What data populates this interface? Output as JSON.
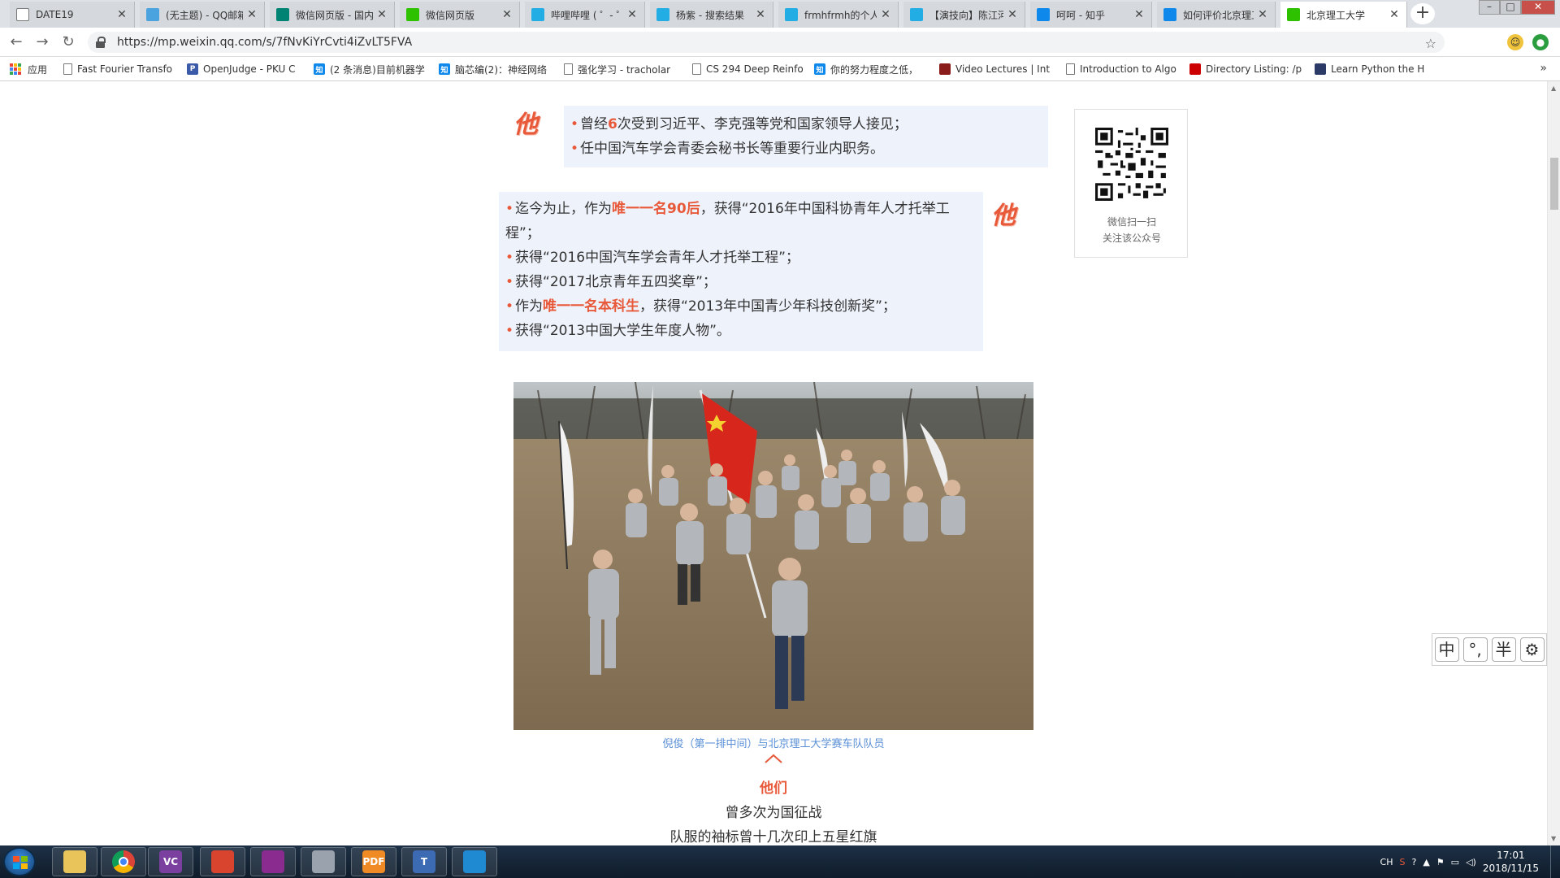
{
  "browser": {
    "tabs": [
      {
        "label": "DATE19",
        "icon": "doc-icon",
        "color": "#ffffff"
      },
      {
        "label": "(无主题) - QQ邮箱",
        "icon": "qq-mail-icon",
        "color": "#4aa3df"
      },
      {
        "label": "微信网页版 - 国内",
        "icon": "bing-icon",
        "color": "#008373"
      },
      {
        "label": "微信网页版",
        "icon": "wechat-icon",
        "color": "#2dc100"
      },
      {
        "label": "哔哩哔哩 ( ゜- ゜)つロ",
        "icon": "bilibili-icon",
        "color": "#23ade5"
      },
      {
        "label": "杨紫 - 搜索结果",
        "icon": "bilibili-icon",
        "color": "#23ade5"
      },
      {
        "label": "frmhfrmh的个人空间",
        "icon": "bilibili-icon",
        "color": "#23ade5"
      },
      {
        "label": "【演技向】陈江河",
        "icon": "bilibili-icon",
        "color": "#23ade5"
      },
      {
        "label": "呵呵 - 知乎",
        "icon": "zhihu-icon",
        "color": "#0f88eb"
      },
      {
        "label": "如何评价北京理工",
        "icon": "zhihu-icon",
        "color": "#0f88eb"
      },
      {
        "label": "北京理工大学",
        "icon": "wechat-icon",
        "color": "#2dc100",
        "active": true
      }
    ],
    "url": "https://mp.weixin.qq.com/s/7fNvKiYrCvti4iZvLT5FVA",
    "bookmarks": [
      {
        "label": "应用",
        "icon": "apps-grid-icon"
      },
      {
        "label": "Fast Fourier Transfo",
        "icon": "doc-icon"
      },
      {
        "label": "OpenJudge - PKU C",
        "icon": "poj-icon",
        "color": "#3b5ba9",
        "mark": "POJ"
      },
      {
        "label": "(2 条消息)目前机器学",
        "icon": "zhihu-icon",
        "color": "#0f88eb",
        "mark": "知"
      },
      {
        "label": "脑芯编(2)：神经网络",
        "icon": "zhihu-icon",
        "color": "#0f88eb",
        "mark": "知"
      },
      {
        "label": "强化学习 - tracholar",
        "icon": "doc-icon"
      },
      {
        "label": "CS 294 Deep Reinfo",
        "icon": "doc-icon"
      },
      {
        "label": "你的努力程度之低，",
        "icon": "zhihu-icon",
        "color": "#0f88eb",
        "mark": "知"
      },
      {
        "label": "Video Lectures | Int",
        "icon": "mit-icon",
        "color": "#8a1c1c"
      },
      {
        "label": "Introduction to Algo",
        "icon": "doc-icon"
      },
      {
        "label": "Directory Listing: /p",
        "icon": "redhat-icon",
        "color": "#cc0000"
      },
      {
        "label": "Learn Python the H",
        "icon": "book-icon",
        "color": "#2b3a67"
      }
    ],
    "more_label": "»",
    "star_label": "☆"
  },
  "article": {
    "panel1": {
      "lines": [
        [
          {
            "t": "曾经"
          },
          {
            "t": "6",
            "hl": true
          },
          {
            "t": "次受到习近平、李克强等党和国家领导人接见；"
          }
        ],
        [
          {
            "t": "任中国汽车学会青委会秘书长等重要行业内职务。"
          }
        ]
      ]
    },
    "ta_char": "他",
    "panel2": {
      "lines": [
        [
          {
            "t": "迄今为止，作为"
          },
          {
            "t": "唯一一名90后",
            "hl": true
          },
          {
            "t": "，获得“2016年中国科协青年人才托举工"
          }
        ],
        [
          {
            "t": "程”；",
            "cont": true
          }
        ],
        [
          {
            "t": "获得“2016中国汽车学会青年人才托举工程”；"
          }
        ],
        [
          {
            "t": "获得“2017北京青年五四奖章”；"
          }
        ],
        [
          {
            "t": "作为"
          },
          {
            "t": "唯一一名本科生",
            "hl": true
          },
          {
            "t": "，获得“2013年中国青少年科技创新奖”；"
          }
        ],
        [
          {
            "t": "获得“2013中国大学生年度人物”。"
          }
        ]
      ]
    },
    "qr_caption_1": "微信扫一扫",
    "qr_caption_2": "关注该公众号",
    "photo_caption": "倪俊（第一排中间）与北京理工大学赛车队队员",
    "tamen": "他们",
    "line1": "曾多次为国征战",
    "line2": "队服的袖标曾十几次印上五星红旗"
  },
  "ime": {
    "labels": [
      "中",
      "°,",
      "半",
      "⚙"
    ]
  },
  "taskbar": {
    "apps": [
      {
        "name": "file-explorer-icon",
        "color": "#e8c45a"
      },
      {
        "name": "chrome-icon",
        "color": "#db4437"
      },
      {
        "name": "visual-c-icon",
        "color": "#7b3fa0",
        "mark": "VC"
      },
      {
        "name": "snail-icon",
        "color": "#d9442f"
      },
      {
        "name": "winrar-icon",
        "color": "#8a2b8f"
      },
      {
        "name": "tool-icon",
        "color": "#9aa3ad"
      },
      {
        "name": "pdf-icon",
        "color": "#f08a24",
        "mark": "PDF"
      },
      {
        "name": "texmaker-icon",
        "color": "#3d6bb3",
        "mark": "T"
      },
      {
        "name": "vscode-icon",
        "color": "#1f8ad2"
      }
    ],
    "tray_lang": "CH",
    "time": "17:01",
    "date": "2018/11/15"
  }
}
